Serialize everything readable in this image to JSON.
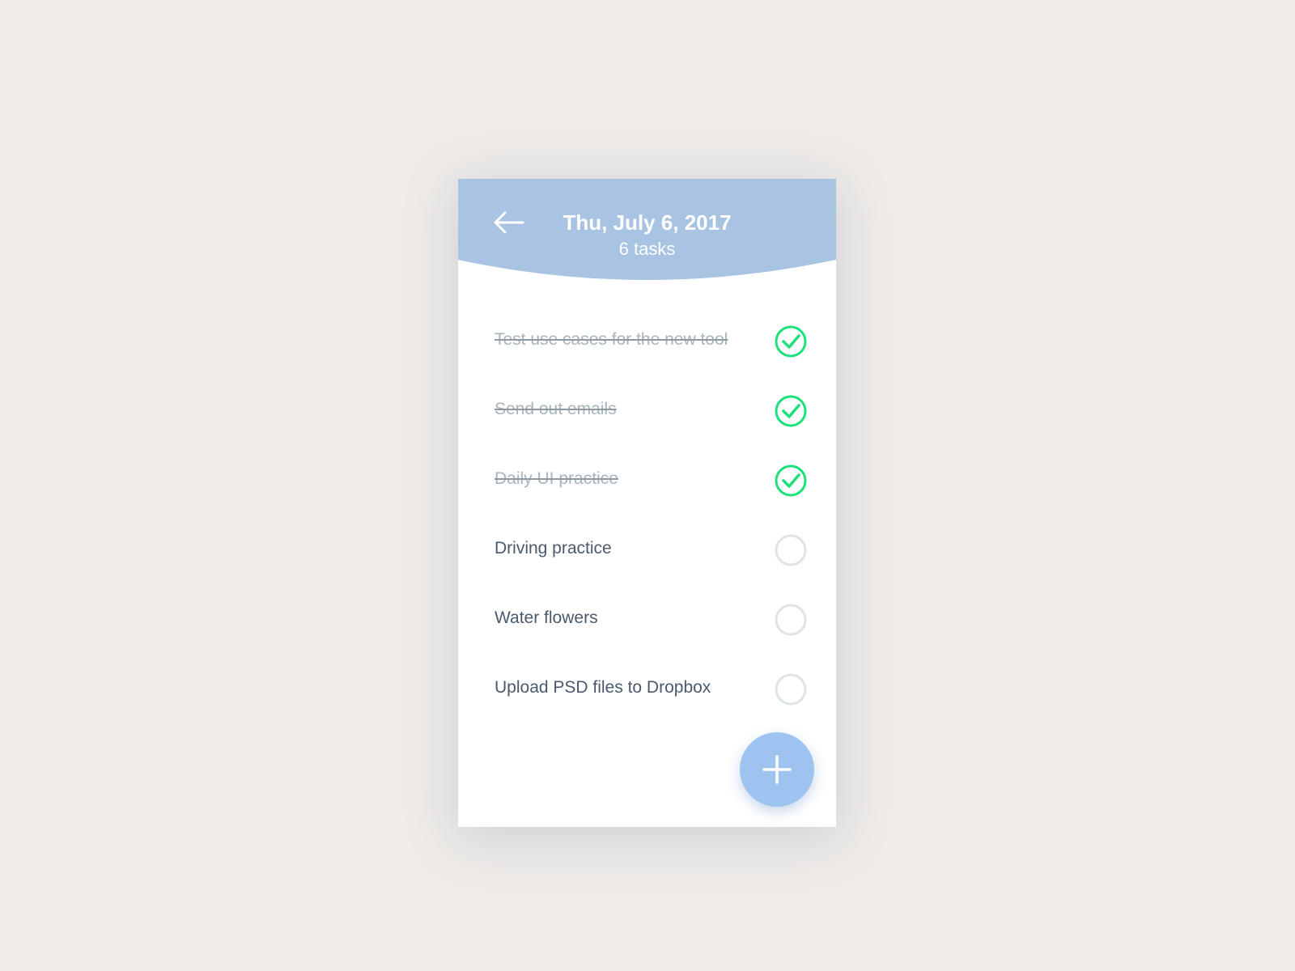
{
  "header": {
    "title": "Thu, July 6, 2017",
    "subtitle": "6 tasks",
    "back_icon": "arrow-left-icon",
    "background_color": "#a9c3e3"
  },
  "tasks": [
    {
      "label": "Test use cases for the new tool",
      "done": true
    },
    {
      "label": "Send out emails",
      "done": true
    },
    {
      "label": "Daily UI practice",
      "done": true
    },
    {
      "label": "Driving practice",
      "done": false
    },
    {
      "label": "Water flowers",
      "done": false
    },
    {
      "label": "Upload PSD files to Dropbox",
      "done": false
    }
  ],
  "fab": {
    "icon": "plus-icon",
    "color": "#9ec3f0"
  },
  "colors": {
    "check_done": "#1ee07a",
    "check_empty": "#dde3e8",
    "page_background": "#eeebe8"
  }
}
